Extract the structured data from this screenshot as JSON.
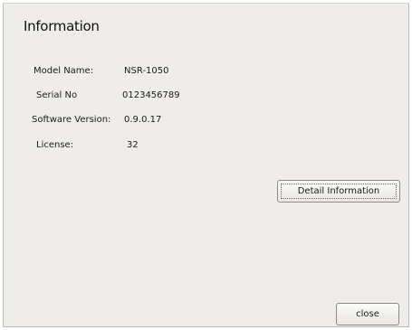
{
  "dialog": {
    "title": "Information",
    "fields": [
      {
        "label": "Model Name:",
        "value": "NSR-1050"
      },
      {
        "label": "Serial No",
        "value": "0123456789"
      },
      {
        "label": "Software Version:",
        "value": "0.9.0.17"
      },
      {
        "label": "License:",
        "value": "32"
      }
    ],
    "detail_button_label": "Detail Information",
    "close_button_label": "close"
  },
  "colors": {
    "dialog_background": "#efedea",
    "button_border": "#8e8b86"
  }
}
